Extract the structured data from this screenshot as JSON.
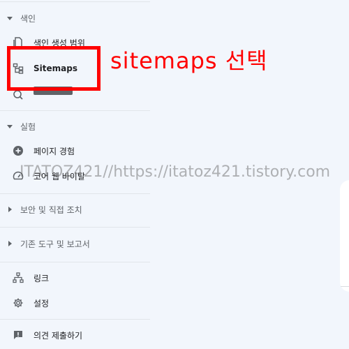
{
  "sidebar": {
    "index_section": {
      "label": "색인",
      "items": [
        {
          "label": "색인 생성 범위",
          "icon": "page-icon"
        },
        {
          "label": "Sitemaps",
          "icon": "sitemap-icon"
        },
        {
          "label": "",
          "icon": "search-magnify-icon"
        }
      ]
    },
    "experience_section": {
      "label": "실험",
      "items": [
        {
          "label": "페이지 경험",
          "icon": "plus-circle-icon"
        },
        {
          "label": "코어 웹 바이탈",
          "icon": "speedometer-icon"
        }
      ]
    },
    "security_section": {
      "label": "보안 및 직접 조치"
    },
    "legacy_section": {
      "label": "기존 도구 및 보고서"
    },
    "links": {
      "label": "링크",
      "icon": "links-icon"
    },
    "settings": {
      "label": "설정",
      "icon": "gear-icon"
    },
    "feedback": {
      "label": "의견 제출하기",
      "icon": "feedback-icon"
    }
  },
  "annotation": {
    "text": "sitemaps 선택",
    "color": "#ff0000"
  },
  "watermark": {
    "text": "ITATOZ421//https://itatoz421.tistory.com"
  }
}
